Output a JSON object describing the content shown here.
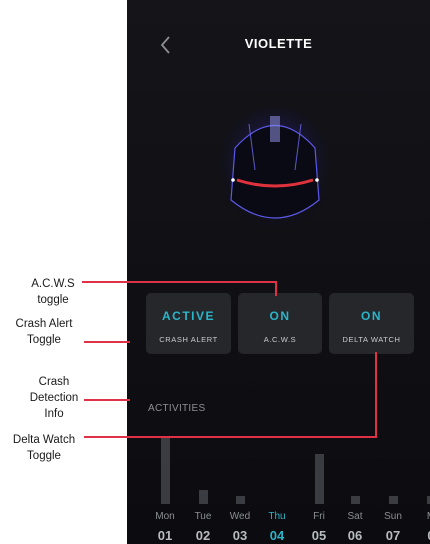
{
  "screen": {
    "title": "VIOLETTE"
  },
  "status_tiles": [
    {
      "value": "ACTIVE",
      "label": "CRASH ALERT"
    },
    {
      "value": "ON",
      "label": "A.C.W.S"
    },
    {
      "value": "ON",
      "label": "DELTA WATCH"
    }
  ],
  "activities": {
    "title": "ACTIVITIES",
    "days": [
      {
        "day": "Mon",
        "date": "01",
        "level": 0.95
      },
      {
        "day": "Tue",
        "date": "02",
        "level": 0.2
      },
      {
        "day": "Wed",
        "date": "03",
        "level": 0.12
      },
      {
        "day": "Thu",
        "date": "04",
        "level": 0.0,
        "selected": true
      },
      {
        "day": "Fri",
        "date": "05",
        "level": 0.72
      },
      {
        "day": "Sat",
        "date": "06",
        "level": 0.12
      },
      {
        "day": "Sun",
        "date": "07",
        "level": 0.12
      },
      {
        "day": "M",
        "date": "0",
        "level": 0.12
      }
    ]
  },
  "annotations": {
    "acws_toggle": "A.C.W.S\ntoggle",
    "crash_alert_toggle": "Crash Alert\nToggle",
    "crash_detection_info": "Crash\nDetection\nInfo",
    "delta_watch_toggle": "Delta Watch\nToggle",
    "leader_color": "#e03246"
  },
  "colors": {
    "accent": "#2bb5c9",
    "background": "#0e0e12",
    "tile": "#25272b",
    "helmet_stripe": "#e0323c"
  }
}
